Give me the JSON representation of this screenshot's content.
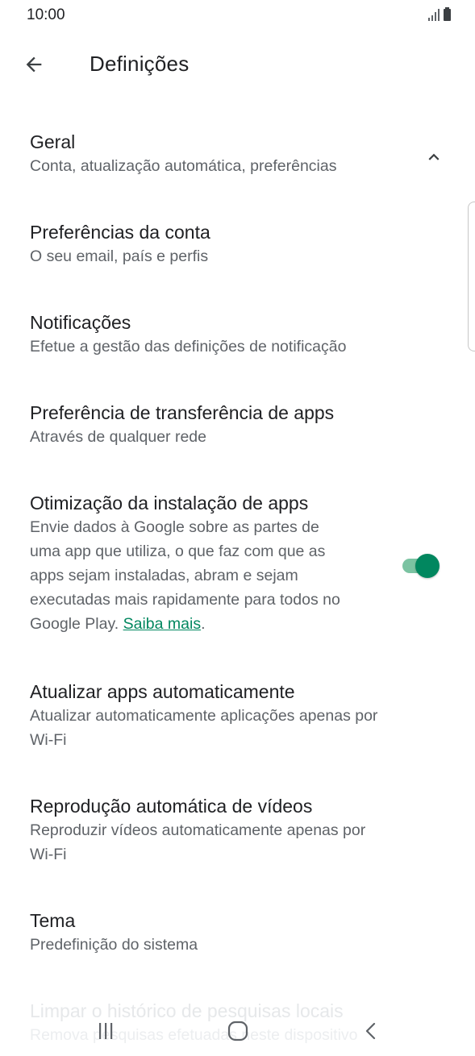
{
  "status_bar": {
    "time": "10:00",
    "signal_icon": "signal-icon",
    "battery_icon": "battery-icon"
  },
  "app_bar": {
    "title": "Definições",
    "back_icon": "arrow-back-icon"
  },
  "sections": {
    "general": {
      "title": "Geral",
      "subtitle": "Conta, atualização automática, preferências",
      "expanded": true,
      "toggle_icon": "chevron-up-icon"
    }
  },
  "items": [
    {
      "title": "Preferências da conta",
      "subtitle": "O seu email, país e perfis"
    },
    {
      "title": "Notificações",
      "subtitle": "Efetue a gestão das definições de notificação"
    },
    {
      "title": "Preferência de transferência de apps",
      "subtitle": "Através de qualquer rede"
    },
    {
      "title": "Otimização da instalação de apps",
      "subtitle_lines": [
        "Envie dados à Google sobre as partes de",
        "uma app que utiliza, o que faz com que as",
        "apps sejam instaladas, abram e sejam",
        "executadas mais rapidamente para todos no"
      ],
      "subtitle_last_prefix": "Google Play. ",
      "link": "Saiba mais",
      "subtitle_last_suffix": ".",
      "toggle_on": true
    },
    {
      "title": "Atualizar apps automaticamente",
      "subtitle_lines": [
        "Atualizar automaticamente aplicações apenas por",
        "Wi-Fi"
      ]
    },
    {
      "title": "Reprodução automática de vídeos",
      "subtitle_lines": [
        "Reproduzir vídeos automaticamente apenas por",
        "Wi-Fi"
      ]
    },
    {
      "title": "Tema",
      "subtitle": "Predefinição do sistema"
    },
    {
      "title": "Limpar o histórico de pesquisas locais",
      "subtitle": "Remova pesquisas efetuadas neste dispositivo"
    }
  ],
  "colors": {
    "accent": "#01875f",
    "toggle_track": "#7bc3a2",
    "text_primary": "#202124",
    "text_secondary": "#5f6368"
  },
  "nav_bar": {
    "recents_icon": "recents-icon",
    "home_icon": "home-icon",
    "back_icon": "nav-back-icon"
  }
}
